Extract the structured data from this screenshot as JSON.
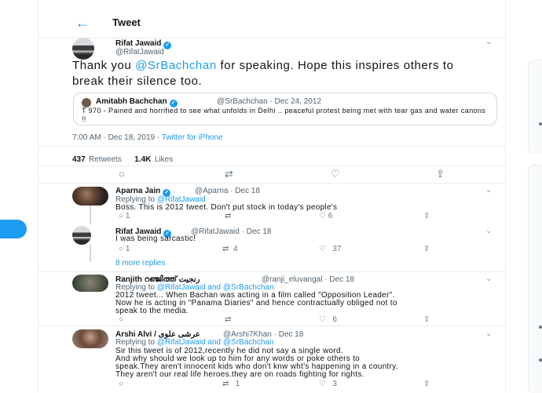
{
  "header": {
    "title": "Tweet",
    "back_icon": "←"
  },
  "main_tweet": {
    "name": "Rifat Jawaid",
    "handle": "@RifatJawaid",
    "text_prefix": "Thank you ",
    "mention": "@SrBachchan",
    "text_suffix": " for speaking. Hope this inspires others to break their silence too.",
    "quoted": {
      "name": "Amitabh Bachchan",
      "handle_date": "@SrBachchan · Dec 24, 2012",
      "text": "T 970 - Pained and horrified to see what unfolds in Delhi .. peaceful protest being met with tear gas and water canons !!"
    },
    "time": "7:00 AM · Dec 18, 2019 · ",
    "source": "Twitter for iPhone",
    "retweets": "437",
    "retweets_label": "Retweets",
    "likes": "1.4K",
    "likes_label": "Likes"
  },
  "replies": [
    {
      "name": "Aparna Jain",
      "handle_date": "@Aparna · Dec 18",
      "replying_prefix": "Replying to ",
      "replying_to": "@RifatJawaid",
      "text": [
        "Boss. This is 2012 tweet. Don't put stock in today's people's"
      ],
      "counts": {
        "reply": "1",
        "retweet": "",
        "like": "6"
      }
    },
    {
      "name": "Rifat Jawaid",
      "handle_date": "@RifatJawaid · Dec 18",
      "text": [
        "I was being sarcastic!"
      ],
      "counts": {
        "reply": "1",
        "retweet": "4",
        "like": "37"
      }
    },
    {
      "name": "Ranjith റഞ്ജിത്ത് رنجیت",
      "handle_date": "@ranji_eluvangal · Dec 18",
      "replying_prefix": "Replying to ",
      "replying_to": "@RifatJawaid and @SrBachchan",
      "text": [
        "2012 tweet... When Bachan was acting in a film called \"Opposition Leader\".",
        "Now he is acting in \"Panama Diaries\" and hence contractually obliged not to",
        "speak to the media."
      ],
      "counts": {
        "reply": "",
        "retweet": "",
        "like": "6"
      }
    },
    {
      "name": "Arshi Alvi / عرشی علوی",
      "handle_date": "@Arshi7Khan · Dec 18",
      "replying_prefix": "Replying to ",
      "replying_to": "@RifatJawaid and @SrBachchan",
      "text": [
        "Sir this tweet is of 2012,recently he did not say a single word.",
        "And why should we look up to him for any words or poke others to",
        "speak.They aren't innocent kids who don't knw wht's happening in a country.",
        "They aren't our real life heroes.they are on roads fighting for rights."
      ],
      "counts": {
        "reply": "",
        "retweet": "1",
        "like": "3"
      }
    }
  ],
  "more_replies": "8 more replies",
  "icons": {
    "reply": "○",
    "retweet": "⇄",
    "like": "♡",
    "share": "⇪",
    "caret": "⌄",
    "verified": "✓"
  },
  "colors": {
    "accent": "#1d9bf0",
    "text": "#0f1419",
    "muted": "#536471",
    "border": "#e6ecf0"
  }
}
